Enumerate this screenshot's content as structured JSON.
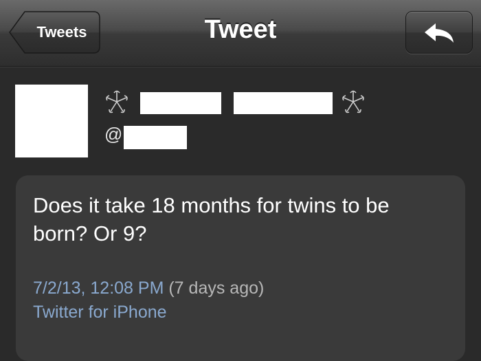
{
  "navbar": {
    "back_label": "Tweets",
    "title": "Tweet",
    "reply_icon": "reply-arrow-icon"
  },
  "author": {
    "decoration_icon": "flower-icon",
    "handle_prefix": "@"
  },
  "tweet": {
    "text": "Does it take 18 months for twins to be born? Or 9?",
    "date": "7/2/13, 12:08 PM",
    "relative": "(7 days ago)",
    "source": "Twitter for iPhone"
  },
  "colors": {
    "background": "#2a2a2a",
    "card": "#3a3a3a",
    "link_blue": "#8aa9cf"
  }
}
